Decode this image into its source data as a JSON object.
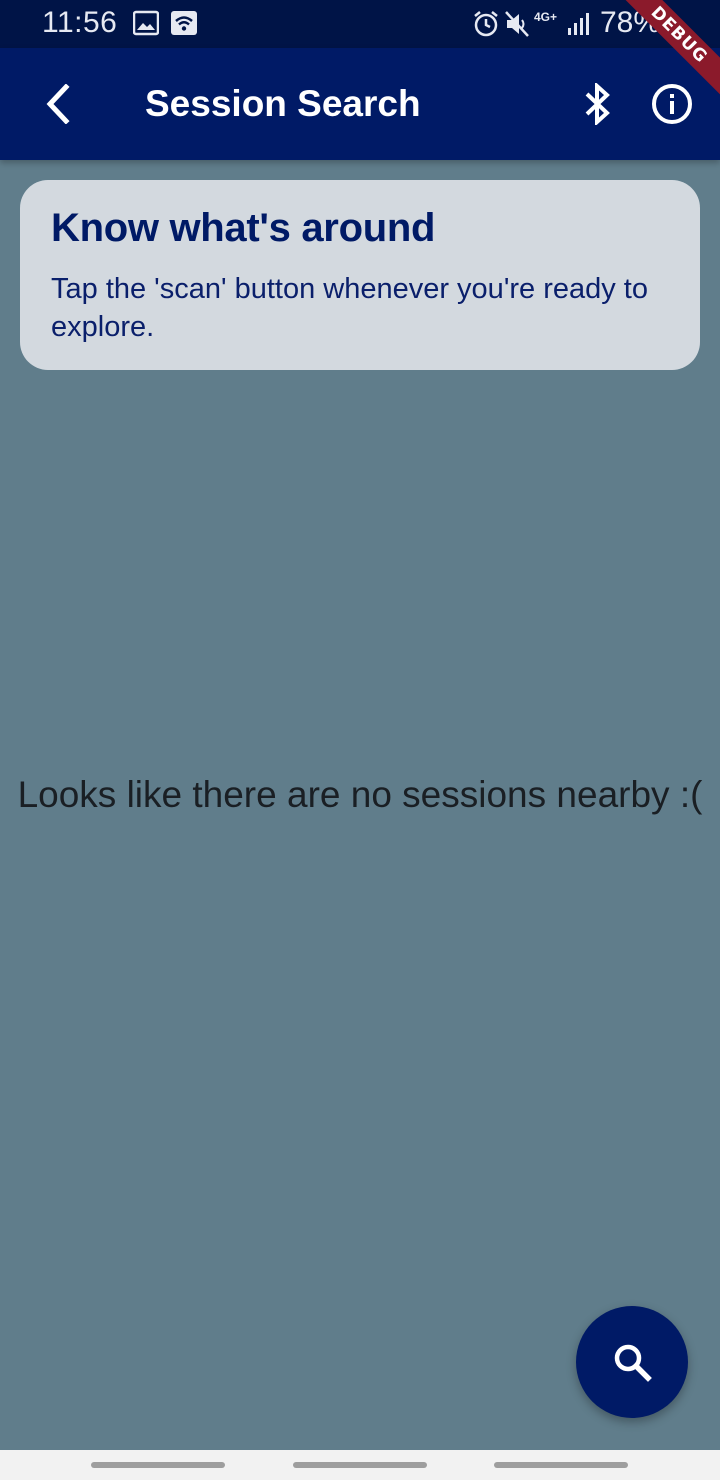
{
  "status_bar": {
    "time": "11:56",
    "battery": "78%",
    "icons": [
      "image-icon",
      "wifi-icon",
      "alarm-icon",
      "mute-icon",
      "network-4g-icon",
      "signal-icon",
      "battery-icon"
    ],
    "network_label": "4G+"
  },
  "debug_banner": "DEBUG",
  "app_bar": {
    "title": "Session Search",
    "back_icon": "back-arrow-icon",
    "actions": [
      "bluetooth-icon",
      "info-icon"
    ]
  },
  "info_card": {
    "title": "Know what's around",
    "body": "Tap the 'scan' button whenever you're ready to explore."
  },
  "empty_state": {
    "message": "Looks like there are no sessions nearby :("
  },
  "fab": {
    "icon": "search-icon"
  },
  "colors": {
    "app_bar": "#001a66",
    "background": "#607d8b",
    "card": "#d3d9df",
    "accent": "#001a66"
  }
}
